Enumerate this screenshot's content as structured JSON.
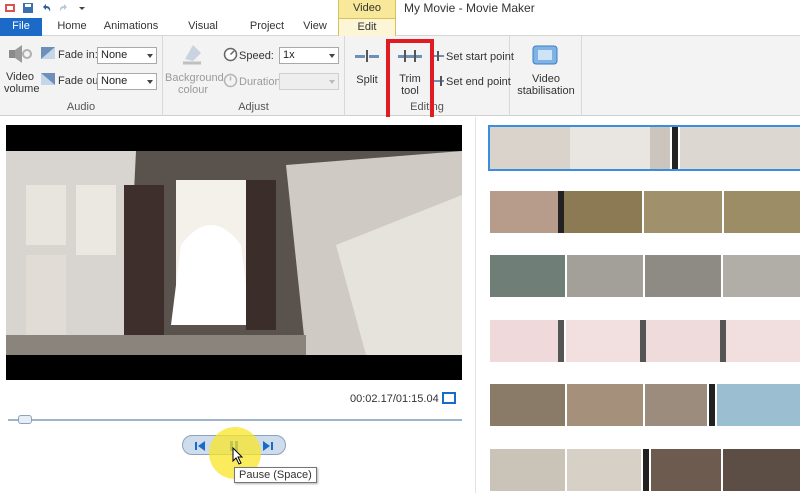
{
  "window": {
    "context_tab": "Video Tools",
    "title": "My Movie - Movie Maker"
  },
  "tabs": [
    {
      "label": "File"
    },
    {
      "label": "Home"
    },
    {
      "label": "Animations"
    },
    {
      "label": "Visual Effects"
    },
    {
      "label": "Project"
    },
    {
      "label": "View"
    },
    {
      "label": "Edit"
    }
  ],
  "ribbon": {
    "audio": {
      "video_volume": "Video volume",
      "fade_in_label": "Fade in:",
      "fade_in_value": "None",
      "fade_out_label": "Fade out:",
      "fade_out_value": "None",
      "group_label": "Audio"
    },
    "adjust": {
      "background_colour": "Background colour",
      "speed_label": "Speed:",
      "speed_value": "1x",
      "duration_label": "Duration:",
      "duration_value": "",
      "group_label": "Adjust"
    },
    "editing": {
      "split": "Split",
      "trim_tool": "Trim tool",
      "set_start_point": "Set start point",
      "set_end_point": "Set end point",
      "group_label": "Editing"
    },
    "stabilisation": {
      "label": "Video stabilisation"
    }
  },
  "preview": {
    "time": "00:02.17/01:15.04",
    "seek_progress": 0.03,
    "tooltip": "Pause (Space)"
  },
  "colors": {
    "file_tab": "#1b6ac8",
    "context_tab": "#f7e89a",
    "highlight": "#e01b24",
    "accent": "#3b8de0"
  }
}
